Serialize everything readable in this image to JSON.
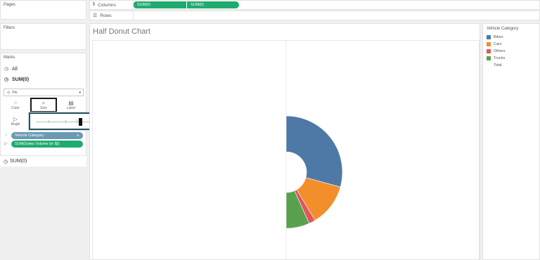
{
  "panels": {
    "pages": "Pages",
    "filters": "Filters",
    "marks": "Marks"
  },
  "marks": {
    "all_label": "All",
    "sum_label": "SUM(0)",
    "mark_type": "Pie",
    "buttons": {
      "color": "Color",
      "size": "Size",
      "label": "Label",
      "angle": "Angle"
    },
    "pills": {
      "vehicle": "Vehicle Category",
      "sales": "SUM(Sales Volume (in $))"
    },
    "sum_label_2": "SUM(0)"
  },
  "shelves": {
    "columns_label": "Columns",
    "rows_label": "Rows",
    "column_pills": [
      "SUM(0)",
      "SUM(0)"
    ]
  },
  "view": {
    "title": "Half Donut Chart"
  },
  "legend": {
    "title": "Vehicle Category",
    "items": [
      {
        "label": "Bikes",
        "color": "#4e79a7"
      },
      {
        "label": "Cars",
        "color": "#f28e2b"
      },
      {
        "label": "Others",
        "color": "#e15759"
      },
      {
        "label": "Trucks",
        "color": "#59a14f"
      },
      {
        "label": "Total",
        "color": ""
      }
    ]
  },
  "chart_data": {
    "type": "pie",
    "categories": [
      "Bikes",
      "Cars",
      "Others",
      "Trucks"
    ],
    "values": [
      51.1,
      21.2,
      3.3,
      11.7
    ],
    "colors": [
      "#4e79a7",
      "#f28e2b",
      "#e15759",
      "#59a14f"
    ],
    "title": "Half Donut Chart"
  }
}
